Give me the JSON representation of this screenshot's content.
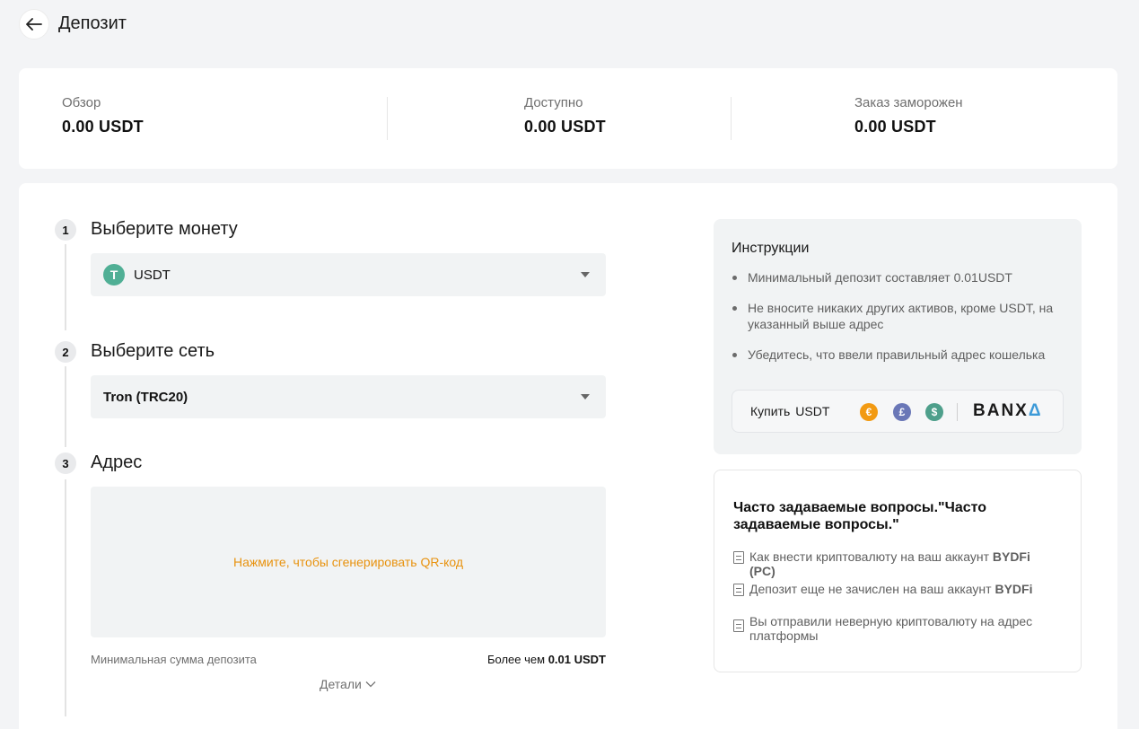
{
  "header": {
    "title": "Депозит"
  },
  "overview": {
    "items": [
      {
        "label": "Обзор",
        "value": "0.00 USDT"
      },
      {
        "label": "Доступно",
        "value": "0.00 USDT"
      },
      {
        "label": "Заказ заморожен",
        "value": "0.00 USDT"
      }
    ]
  },
  "steps": [
    {
      "number": "1",
      "title": "Выберите монету",
      "value": "USDT",
      "coin_icon": "T"
    },
    {
      "number": "2",
      "title": "Выберите сеть",
      "value": "Tron (TRC20)"
    },
    {
      "number": "3",
      "title": "Адрес",
      "qr_prompt": "Нажмите, чтобы сгенерировать QR-код"
    }
  ],
  "min_deposit": {
    "label": "Минимальная сумма депозита",
    "prefix": "Более чем",
    "value": "0.01 USDT"
  },
  "details_label": "Детали",
  "instructions": {
    "title": "Инструкции",
    "items": [
      "Минимальный депозит составляет 0.01USDT",
      "Не вносите никаких других активов, кроме USDT, на указанный выше адрес",
      "Убедитесь, что ввели правильный адрес кошелька"
    ],
    "buy": {
      "label": "Купить",
      "asset": "USDT",
      "currencies": [
        {
          "symbol": "€",
          "color": "#f29a12"
        },
        {
          "symbol": "£",
          "color": "#6a77b7"
        },
        {
          "symbol": "$",
          "color": "#4e9f8b"
        }
      ],
      "provider": "BANX",
      "provider_suffix": "Δ",
      "accent_color": "#3c9ad8"
    }
  },
  "faq": {
    "title": "Часто задаваемые вопросы.\"Часто задаваемые вопросы.\"",
    "items": [
      {
        "text": "Как внести криптовалюту на ваш аккаунт",
        "bold": "BYDFi (PC)"
      },
      {
        "text": "Депозит еще не зачислен на ваш аккаунт",
        "bold": "BYDFi"
      },
      {
        "text": "Вы отправили неверную криптовалюту на адрес платформы",
        "bold": ""
      }
    ]
  }
}
